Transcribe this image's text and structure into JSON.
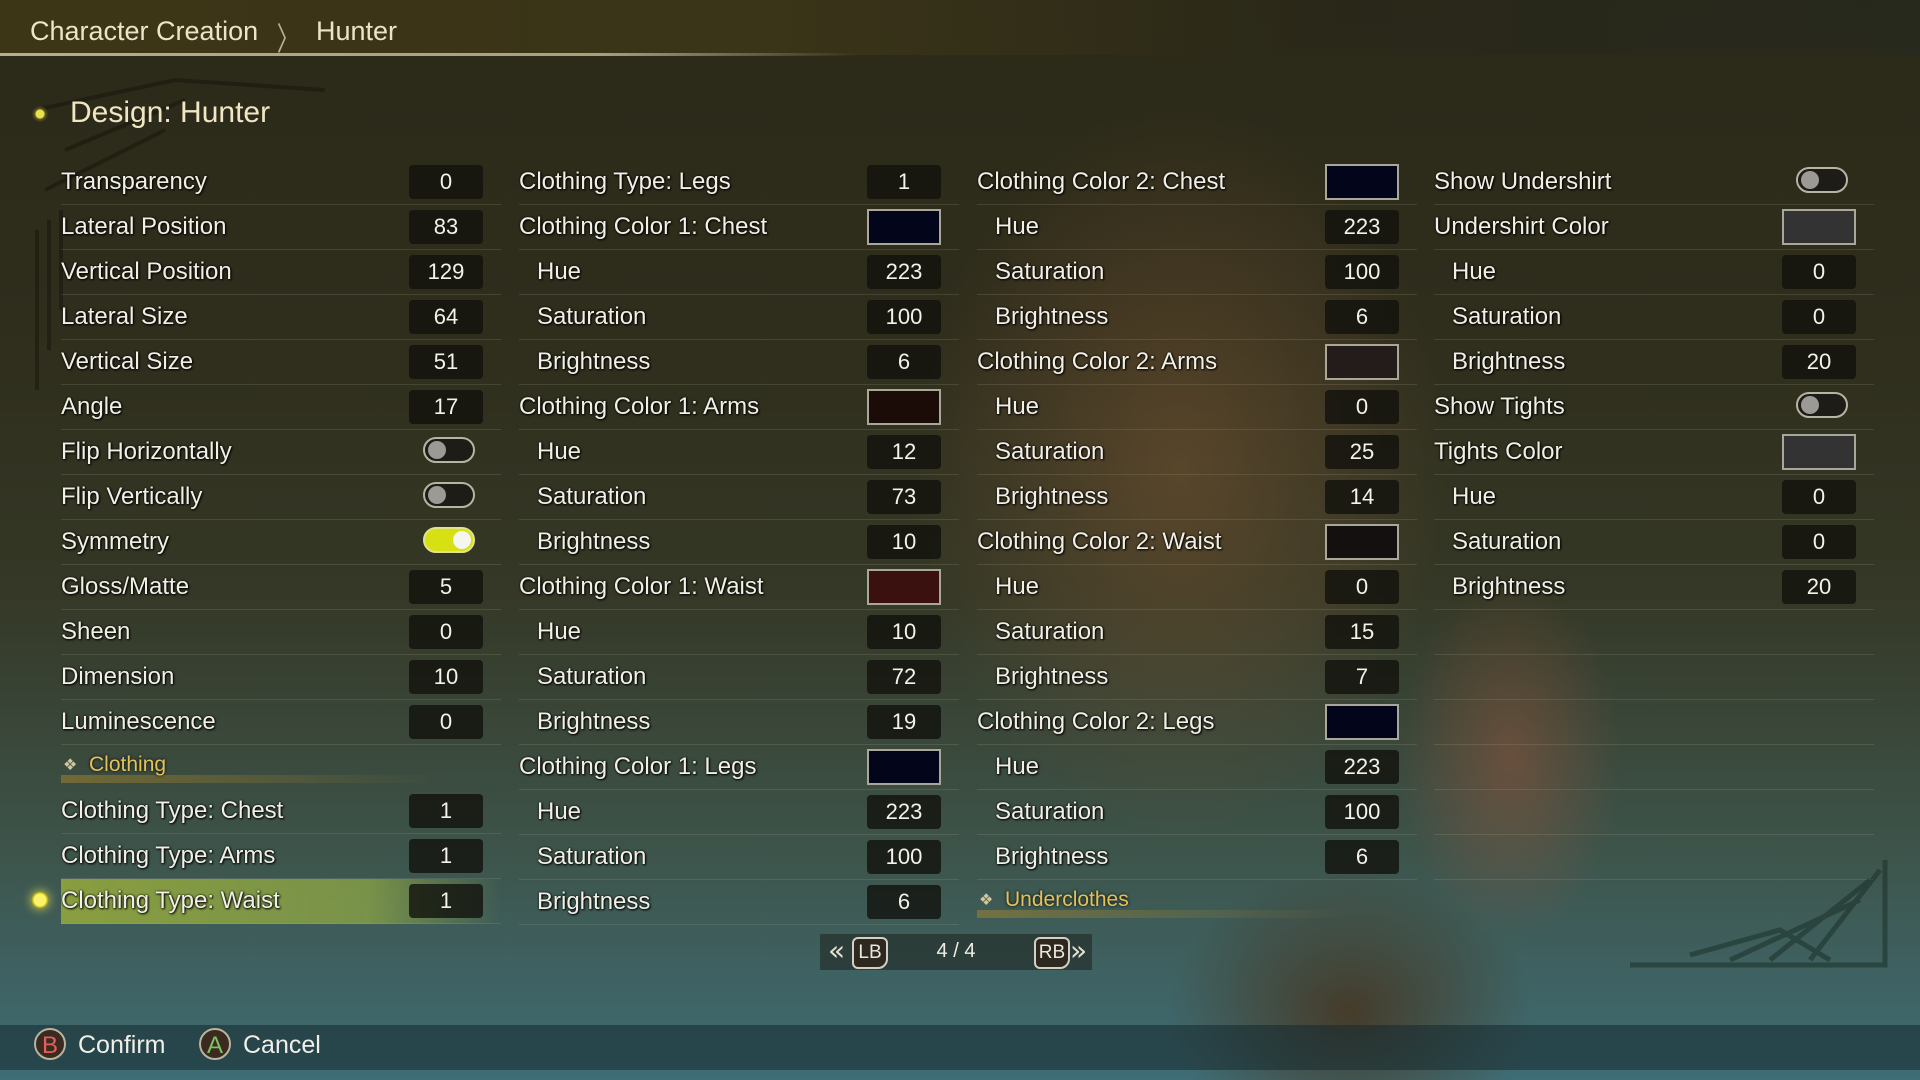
{
  "breadcrumb": {
    "items": [
      "Character Creation",
      "Hunter"
    ]
  },
  "page_title": "Design: Hunter",
  "colors": {
    "accent": "#d7e012",
    "section": "#e3c25a",
    "confirm": "#e06060",
    "cancel": "#7fc060"
  },
  "columns": [
    {
      "rows": [
        {
          "type": "value",
          "label": "Transparency",
          "value": "0"
        },
        {
          "type": "value",
          "label": "Lateral Position",
          "value": "83"
        },
        {
          "type": "value",
          "label": "Vertical Position",
          "value": "129"
        },
        {
          "type": "value",
          "label": "Lateral Size",
          "value": "64"
        },
        {
          "type": "value",
          "label": "Vertical Size",
          "value": "51"
        },
        {
          "type": "value",
          "label": "Angle",
          "value": "17"
        },
        {
          "type": "toggle",
          "label": "Flip Horizontally",
          "on": false
        },
        {
          "type": "toggle",
          "label": "Flip Vertically",
          "on": false
        },
        {
          "type": "toggle",
          "label": "Symmetry",
          "on": true
        },
        {
          "type": "value",
          "label": "Gloss/Matte",
          "value": "5"
        },
        {
          "type": "value",
          "label": "Sheen",
          "value": "0"
        },
        {
          "type": "value",
          "label": "Dimension",
          "value": "10"
        },
        {
          "type": "value",
          "label": "Luminescence",
          "value": "0"
        },
        {
          "type": "section",
          "label": "Clothing"
        },
        {
          "type": "value",
          "label": "Clothing Type: Chest",
          "value": "1"
        },
        {
          "type": "value",
          "label": "Clothing Type: Arms",
          "value": "1"
        },
        {
          "type": "value",
          "label": "Clothing Type: Waist",
          "value": "1",
          "selected": true
        }
      ]
    },
    {
      "rows": [
        {
          "type": "value",
          "label": "Clothing Type: Legs",
          "value": "1"
        },
        {
          "type": "swatch",
          "label": "Clothing Color 1: Chest",
          "color": "#03061a"
        },
        {
          "type": "value",
          "label": "Hue",
          "value": "223",
          "sub": true
        },
        {
          "type": "value",
          "label": "Saturation",
          "value": "100",
          "sub": true
        },
        {
          "type": "value",
          "label": "Brightness",
          "value": "6",
          "sub": true
        },
        {
          "type": "swatch",
          "label": "Clothing Color 1: Arms",
          "color": "#1c0c08"
        },
        {
          "type": "value",
          "label": "Hue",
          "value": "12",
          "sub": true
        },
        {
          "type": "value",
          "label": "Saturation",
          "value": "73",
          "sub": true
        },
        {
          "type": "value",
          "label": "Brightness",
          "value": "10",
          "sub": true
        },
        {
          "type": "swatch",
          "label": "Clothing Color 1: Waist",
          "color": "#3a110e"
        },
        {
          "type": "value",
          "label": "Hue",
          "value": "10",
          "sub": true
        },
        {
          "type": "value",
          "label": "Saturation",
          "value": "72",
          "sub": true
        },
        {
          "type": "value",
          "label": "Brightness",
          "value": "19",
          "sub": true
        },
        {
          "type": "swatch",
          "label": "Clothing Color 1: Legs",
          "color": "#03061a"
        },
        {
          "type": "value",
          "label": "Hue",
          "value": "223",
          "sub": true
        },
        {
          "type": "value",
          "label": "Saturation",
          "value": "100",
          "sub": true
        },
        {
          "type": "value",
          "label": "Brightness",
          "value": "6",
          "sub": true
        }
      ]
    },
    {
      "rows": [
        {
          "type": "swatch",
          "label": "Clothing Color 2: Chest",
          "color": "#03061a"
        },
        {
          "type": "value",
          "label": "Hue",
          "value": "223",
          "sub": true
        },
        {
          "type": "value",
          "label": "Saturation",
          "value": "100",
          "sub": true
        },
        {
          "type": "value",
          "label": "Brightness",
          "value": "6",
          "sub": true
        },
        {
          "type": "swatch",
          "label": "Clothing Color 2: Arms",
          "color": "#241b1b"
        },
        {
          "type": "value",
          "label": "Hue",
          "value": "0",
          "sub": true
        },
        {
          "type": "value",
          "label": "Saturation",
          "value": "25",
          "sub": true
        },
        {
          "type": "value",
          "label": "Brightness",
          "value": "14",
          "sub": true
        },
        {
          "type": "swatch",
          "label": "Clothing Color 2: Waist",
          "color": "#141010"
        },
        {
          "type": "value",
          "label": "Hue",
          "value": "0",
          "sub": true
        },
        {
          "type": "value",
          "label": "Saturation",
          "value": "15",
          "sub": true
        },
        {
          "type": "value",
          "label": "Brightness",
          "value": "7",
          "sub": true
        },
        {
          "type": "swatch",
          "label": "Clothing Color 2: Legs",
          "color": "#03061a"
        },
        {
          "type": "value",
          "label": "Hue",
          "value": "223",
          "sub": true
        },
        {
          "type": "value",
          "label": "Saturation",
          "value": "100",
          "sub": true
        },
        {
          "type": "value",
          "label": "Brightness",
          "value": "6",
          "sub": true
        },
        {
          "type": "section",
          "label": "Underclothes"
        }
      ]
    },
    {
      "rows": [
        {
          "type": "toggle",
          "label": "Show Undershirt",
          "on": false
        },
        {
          "type": "swatch",
          "label": "Undershirt Color",
          "color": "#333333"
        },
        {
          "type": "value",
          "label": "Hue",
          "value": "0",
          "sub": true
        },
        {
          "type": "value",
          "label": "Saturation",
          "value": "0",
          "sub": true
        },
        {
          "type": "value",
          "label": "Brightness",
          "value": "20",
          "sub": true
        },
        {
          "type": "toggle",
          "label": "Show Tights",
          "on": false
        },
        {
          "type": "swatch",
          "label": "Tights Color",
          "color": "#333333"
        },
        {
          "type": "value",
          "label": "Hue",
          "value": "0",
          "sub": true
        },
        {
          "type": "value",
          "label": "Saturation",
          "value": "0",
          "sub": true
        },
        {
          "type": "value",
          "label": "Brightness",
          "value": "20",
          "sub": true
        },
        {
          "type": "empty"
        },
        {
          "type": "empty"
        },
        {
          "type": "empty"
        },
        {
          "type": "empty"
        },
        {
          "type": "empty"
        },
        {
          "type": "empty"
        }
      ]
    }
  ],
  "pager": {
    "prev_button": "LB",
    "next_button": "RB",
    "page": "4 / 4"
  },
  "footer": {
    "confirm": {
      "key": "B",
      "label": "Confirm"
    },
    "cancel": {
      "key": "A",
      "label": "Cancel"
    }
  }
}
